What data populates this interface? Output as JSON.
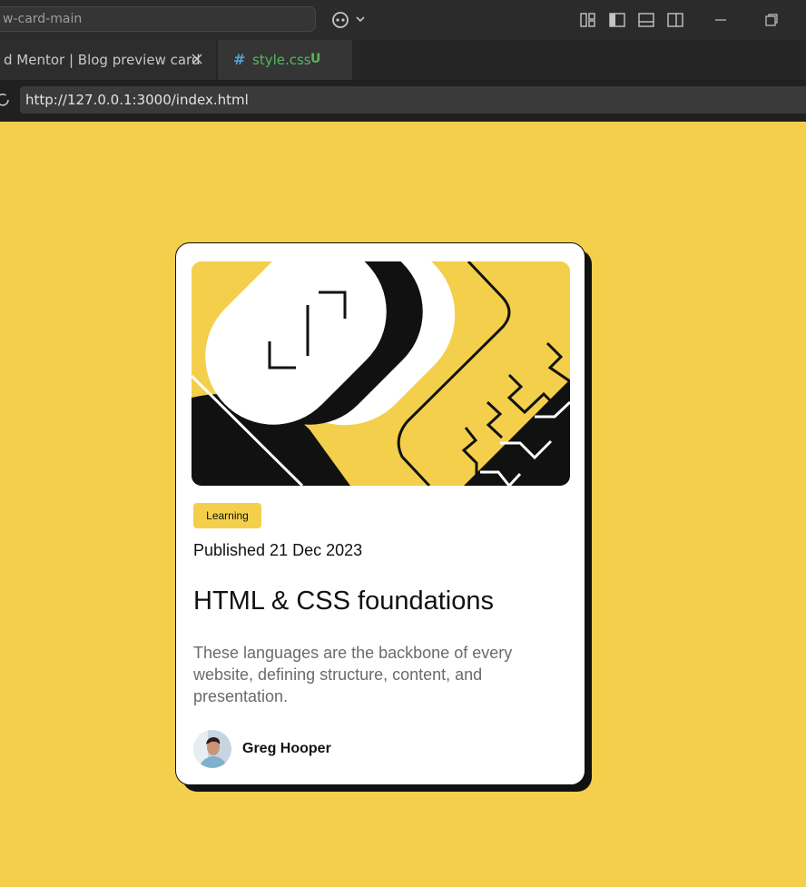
{
  "titlebar": {
    "search_text": "w-card-main"
  },
  "tabs": [
    {
      "label": "d Mentor | Blog preview card",
      "active": false
    },
    {
      "icon": "#",
      "label": "style.css",
      "status": "U",
      "active": true
    }
  ],
  "browser": {
    "url": "http://127.0.0.1:3000/index.html"
  },
  "card": {
    "tag": "Learning",
    "published": "Published 21 Dec 2023",
    "title": "HTML & CSS foundations",
    "description": "These languages are the backbone of every website, defining structure, content, and presentation.",
    "author": "Greg Hooper"
  },
  "colors": {
    "accent": "#f4cf4c",
    "ink": "#111111",
    "muted": "#6b6b6b"
  }
}
